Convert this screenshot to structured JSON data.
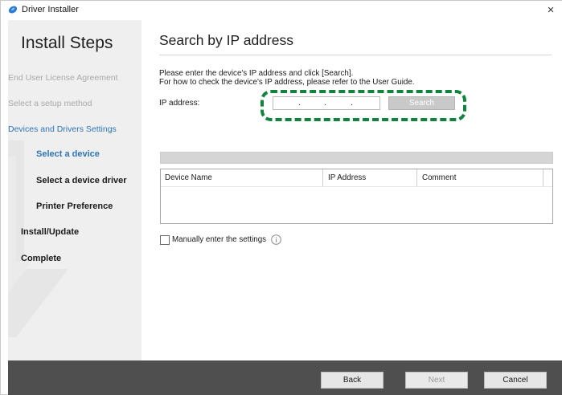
{
  "window": {
    "title": "Driver Installer",
    "close_glyph": "×",
    "app_icon": "driver-installer-logo"
  },
  "sidebar": {
    "title": "Install Steps",
    "steps": {
      "eula": "End User License Agreement",
      "setup_method": "Select a setup method",
      "devices_drivers": "Devices and Drivers Settings",
      "select_device": "Select a device",
      "select_driver": "Select a device driver",
      "printer_pref": "Printer Preference",
      "install_update": "Install/Update",
      "complete": "Complete"
    }
  },
  "main": {
    "page_title": "Search by IP address",
    "instruction_1": "Please enter the device's IP address and click [Search].",
    "instruction_2": "For how to check the device's IP address, please refer to the User Guide.",
    "ip_label": "IP address:",
    "ip_value": [
      "",
      "",
      "",
      ""
    ],
    "search_label": "Search",
    "table": {
      "columns": [
        "Device Name",
        "IP Address",
        "Comment"
      ],
      "rows": []
    },
    "manual_label": "Manually enter the settings",
    "manual_checked": false,
    "info_icon": "info-icon"
  },
  "footer": {
    "back_label": "Back",
    "next_label": "Next",
    "cancel_label": "Cancel"
  },
  "colors": {
    "accent_blue": "#2e75b6",
    "highlight_green": "#12833c",
    "footer_bg": "#4f4f4f",
    "sidebar_bg": "#efefef"
  }
}
